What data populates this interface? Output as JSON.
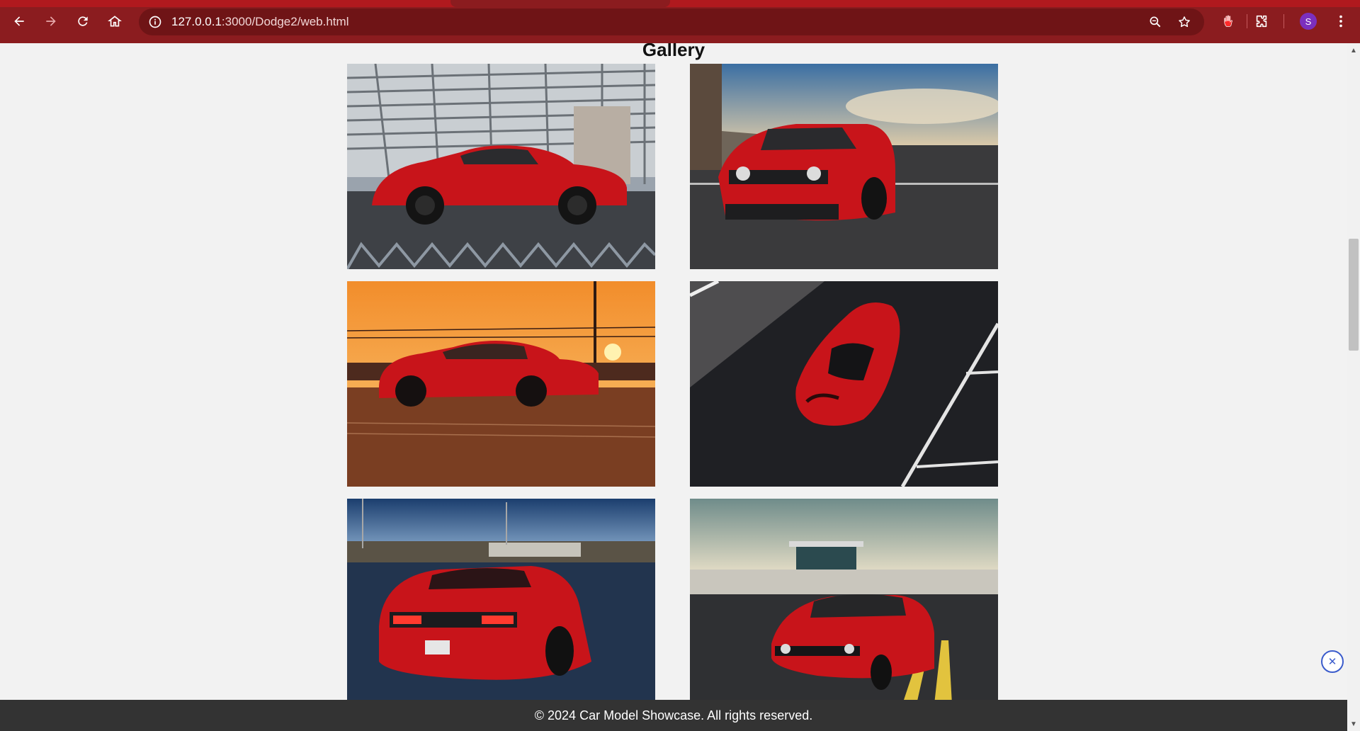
{
  "browser": {
    "url_host": "127.0.0.1",
    "url_path": ":3000/Dodge2/web.html",
    "profile_initial": "S"
  },
  "page": {
    "gallery_title": "Gallery",
    "footer_text": "© 2024 Car Model Showcase. All rights reserved."
  },
  "gallery": {
    "images": [
      {
        "name": "gallery-image-1",
        "scene": "red car side view, grandstand background"
      },
      {
        "name": "gallery-image-2",
        "scene": "red car front three-quarter view on track"
      },
      {
        "name": "gallery-image-3",
        "scene": "red car side view at sunset"
      },
      {
        "name": "gallery-image-4",
        "scene": "red car top-down view on asphalt"
      },
      {
        "name": "gallery-image-5",
        "scene": "red car rear three-quarter view at dusk"
      },
      {
        "name": "gallery-image-6",
        "scene": "red car front view on drag strip"
      }
    ]
  },
  "colors": {
    "chrome": "#8b1c1f",
    "omnibox": "#6f1416",
    "page_background": "#f2f2f2",
    "footer": "#333333",
    "car_red": "#c8141a"
  }
}
